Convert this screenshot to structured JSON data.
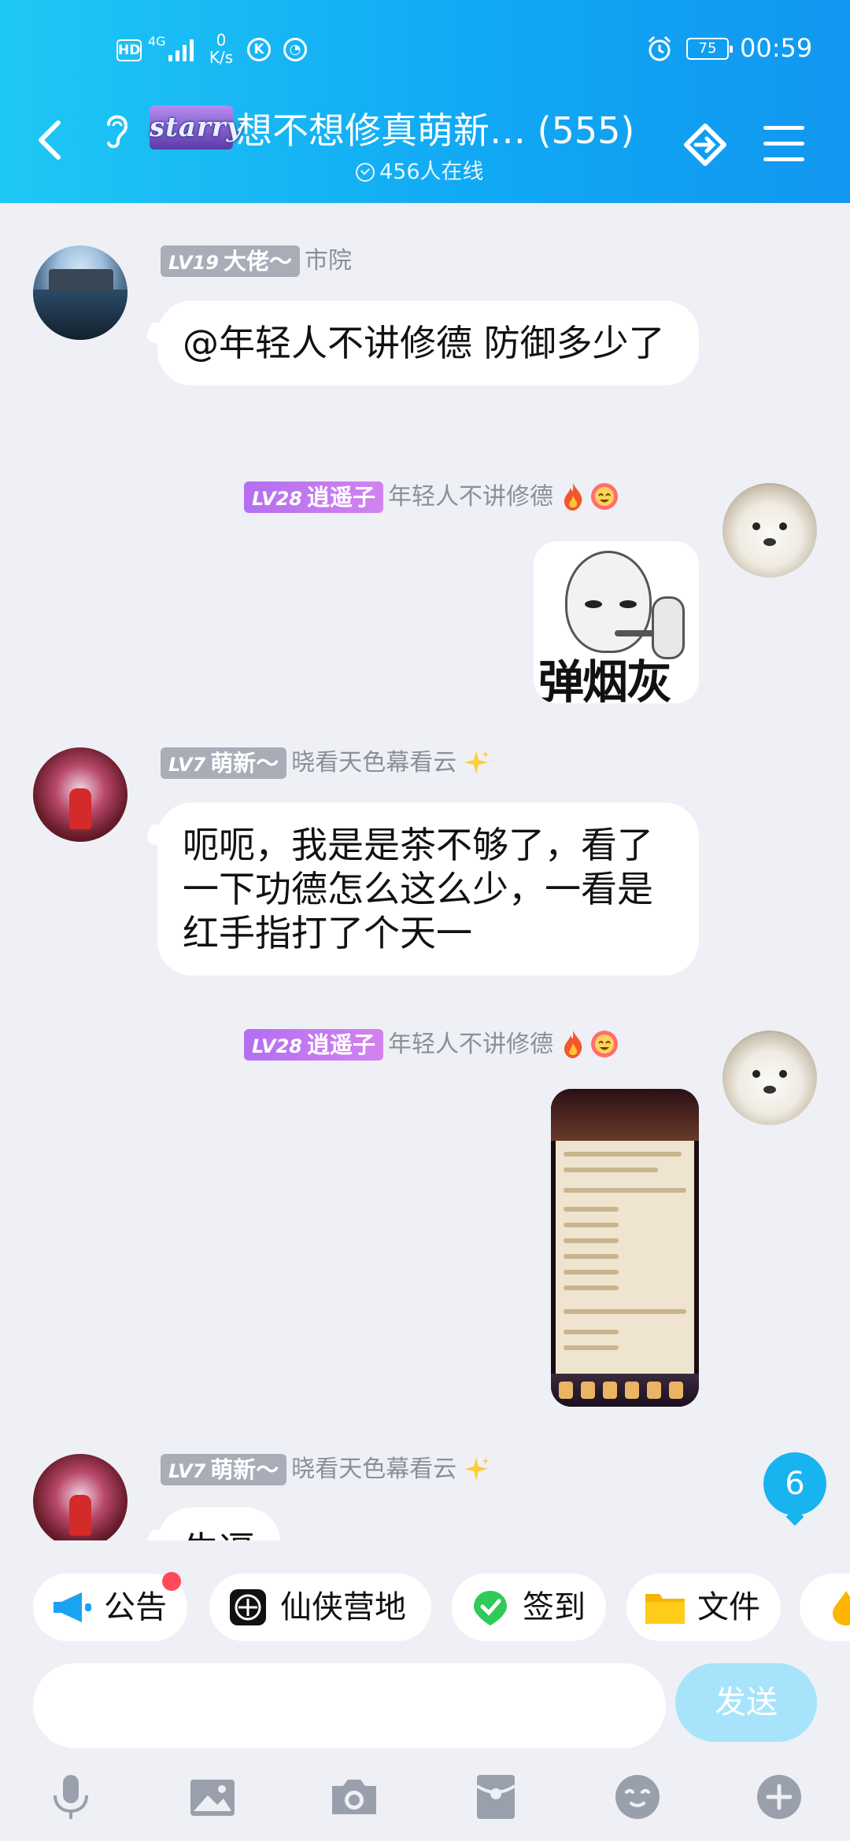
{
  "status_bar": {
    "hd": "HD",
    "network": "4G",
    "speed_value": "0",
    "speed_unit": "K/s",
    "battery": "75",
    "time": "00:59"
  },
  "header": {
    "brand_text": "starry",
    "title": "想不想修真萌新… (555)",
    "online": "456人在线",
    "colors": {
      "gradient_start": "#1ec8f5",
      "gradient_end": "#1197f0"
    }
  },
  "messages": [
    {
      "badge_lv": "LV19",
      "badge_title": "大佬～",
      "name": "市院",
      "text": "@年轻人不讲修德 防御多少了"
    },
    {
      "badge_lv": "LV28",
      "badge_title": "逍遥子",
      "name": "年轻人不讲修德",
      "sticker_text": "弹烟灰"
    },
    {
      "badge_lv": "LV7",
      "badge_title": "萌新～",
      "name": "晓看天色幕看云",
      "text": "呃呃，我是是茶不够了，看了一下功德怎么这么少，一看是红手指打了个天一"
    },
    {
      "badge_lv": "LV28",
      "badge_title": "逍遥子",
      "name": "年轻人不讲修德"
    },
    {
      "badge_lv": "LV7",
      "badge_title": "萌新～",
      "name": "晓看天色幕看云",
      "text": "牛逼"
    }
  ],
  "unread_count": "6",
  "shortcuts": [
    {
      "label": "公告",
      "icon": "megaphone-icon"
    },
    {
      "label": "仙侠营地",
      "icon": "camp-icon"
    },
    {
      "label": "签到",
      "icon": "checkin-icon"
    },
    {
      "label": "文件",
      "icon": "folder-icon"
    }
  ],
  "input": {
    "placeholder": "",
    "send_label": "发送"
  },
  "toolbar": [
    "mic-icon",
    "image-icon",
    "camera-icon",
    "red-packet-icon",
    "emoji-icon",
    "plus-icon"
  ]
}
